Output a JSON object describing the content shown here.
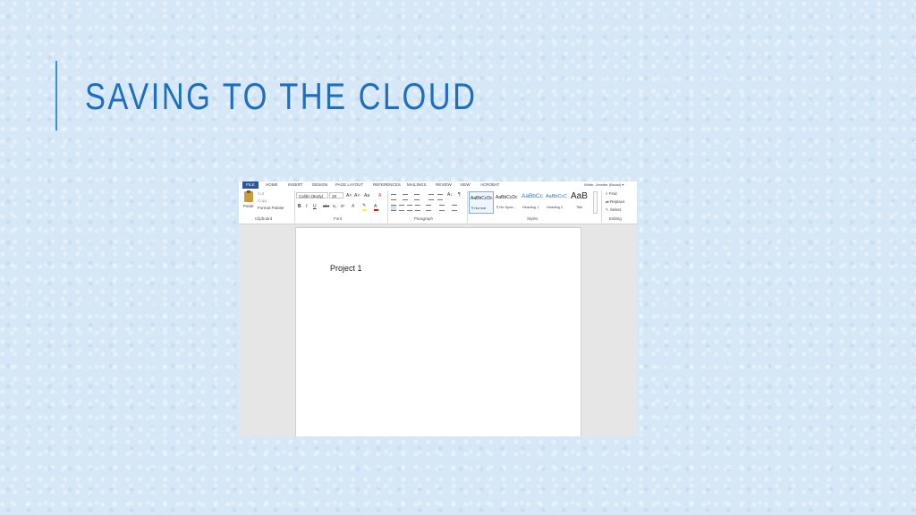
{
  "slide": {
    "title": "SAVING TO THE CLOUD"
  },
  "word": {
    "tabs": [
      "FILE",
      "HOME",
      "INSERT",
      "DESIGN",
      "PAGE LAYOUT",
      "REFERENCES",
      "MAILINGS",
      "REVIEW",
      "VIEW",
      "ACROBAT"
    ],
    "user": "White, Jennifer (Broad) ▾",
    "clipboard": {
      "paste": "Paste",
      "cut": "Cut",
      "copy": "Copy",
      "format_painter": "Format Painter",
      "group": "Clipboard"
    },
    "font": {
      "name": "Calibri (Body)",
      "size": "28",
      "group": "Font",
      "bold": "B",
      "italic": "I",
      "underline": "U",
      "strike": "abc",
      "subscript": "x₂",
      "superscript": "x²",
      "grow": "A˄",
      "shrink": "A˅",
      "case": "Aa",
      "clear": "A"
    },
    "paragraph": {
      "group": "Paragraph",
      "sort": "A↓",
      "marks": "¶"
    },
    "styles": {
      "group": "Styles",
      "items": [
        {
          "sample": "AaBbCcDc",
          "name": "¶ Normal"
        },
        {
          "sample": "AaBbCcDc",
          "name": "¶ No Spac..."
        },
        {
          "sample": "AaBbCc",
          "name": "Heading 1"
        },
        {
          "sample": "AaBbCcC",
          "name": "Heading 2"
        },
        {
          "sample": "AaB",
          "name": "Title"
        }
      ]
    },
    "editing": {
      "find": "Find",
      "replace": "Replace",
      "select": "Select",
      "group": "Editing"
    },
    "document": {
      "text": "Project 1"
    }
  },
  "colors": {
    "title": "#1f6fbf",
    "accent": "#3a8fd6",
    "file_tab": "#2b579a",
    "background": "#d6e8f7"
  }
}
